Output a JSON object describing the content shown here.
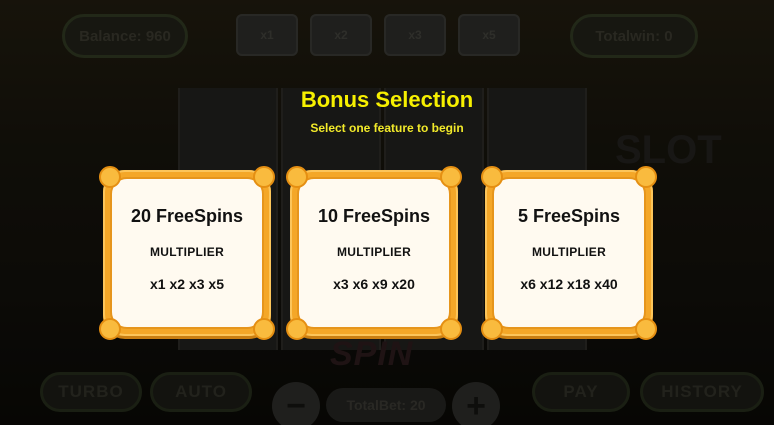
{
  "header": {
    "balance_label": "Balance: 960",
    "totalwin_label": "Totalwin: 0",
    "top_tiles": [
      "x1",
      "x2",
      "x3",
      "x5"
    ]
  },
  "footer": {
    "auto_left_label": "TURBO",
    "auto_label": "AUTO",
    "minus_label": "−",
    "totalbet_label": "TotalBet: 20",
    "plus_label": "+",
    "pay_label": "PAY",
    "history_label": "HISTORY",
    "spin_label": "SPIN"
  },
  "logo_text": "SLOT",
  "bonus": {
    "title": "Bonus Selection",
    "subtitle": "Select one feature to begin",
    "options": [
      {
        "title": "20 FreeSpins",
        "label": "MULTIPLIER",
        "values": "x1 x2 x3 x5"
      },
      {
        "title": "10 FreeSpins",
        "label": "MULTIPLIER",
        "values": "x3 x6 x9 x20"
      },
      {
        "title": "5 FreeSpins",
        "label": "MULTIPLIER",
        "values": "x6 x12 x18 x40"
      }
    ]
  },
  "colors": {
    "title_yellow": "#f7f000",
    "card_orange": "#f4a728",
    "card_fill": "#fffaf0"
  }
}
